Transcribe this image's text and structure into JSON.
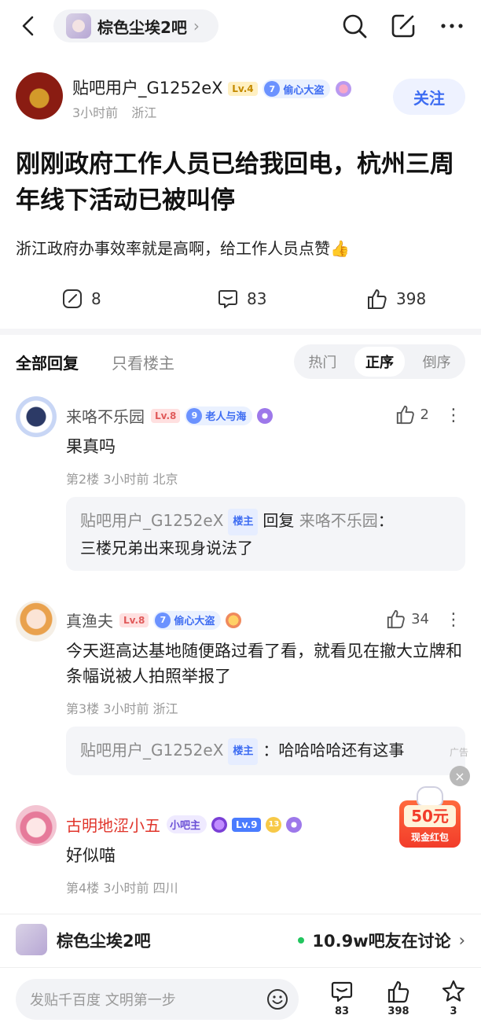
{
  "topbar": {
    "forum_name": "棕色尘埃2吧",
    "chevron": "›"
  },
  "author": {
    "name": "贴吧用户_G1252eX",
    "level": "Lv.4",
    "title_num": "7",
    "title": "偷心大盗",
    "time": "3小时前",
    "location": "浙江",
    "follow_label": "关注"
  },
  "post": {
    "title": "刚刚政府工作人员已给我回电，杭州三周年线下活动已被叫停",
    "body": "浙江政府办事效率就是高啊，给工作人员点赞👍",
    "actions": {
      "share_count": "8",
      "comment_count": "83",
      "like_count": "398"
    }
  },
  "reply_tabs": {
    "all": "全部回复",
    "op_only": "只看楼主",
    "sort": [
      "热门",
      "正序",
      "倒序"
    ]
  },
  "comments": [
    {
      "name": "来咯不乐园",
      "level": "Lv.8",
      "tag_num": "9",
      "tag": "老人与海",
      "likes": "2",
      "text": "果真吗",
      "meta": "第2楼 3小时前 北京",
      "quote": {
        "user": "贴吧用户_G1252eX",
        "badge": "楼主",
        "reply_word": "回复",
        "reply_to": "来咯不乐园",
        "colon": "：",
        "text": "三楼兄弟出来现身说法了"
      }
    },
    {
      "name": "真渔夫",
      "level": "Lv.8",
      "tag_num": "7",
      "tag": "偷心大盗",
      "likes": "34",
      "text": "今天逛高达基地随便路过看了看，就看见在撤大立牌和条幅说被人拍照举报了",
      "meta": "第3楼 3小时前 浙江",
      "quote": {
        "user": "贴吧用户_G1252eX",
        "badge": "楼主",
        "text": "：哈哈哈哈还有这事"
      }
    },
    {
      "name": "古明地涩小五",
      "badge": "小吧主",
      "level": "Lv.9",
      "tag_num": "13",
      "text": "好似喵",
      "meta": "第4楼 3小时前 四川"
    }
  ],
  "ad": {
    "label": "广告",
    "close": "×",
    "amount": "50元",
    "sub": "现金红包"
  },
  "forum_banner": {
    "name": "棕色尘埃2吧",
    "online": "10.9w吧友在讨论"
  },
  "bottom_bar": {
    "placeholder": "发贴千百度 文明第一步",
    "comments": "83",
    "likes": "398",
    "stars": "3"
  },
  "colors": {
    "accent_blue": "#3d6cf2",
    "name_red": "#e0352b",
    "online_green": "#22c55e"
  }
}
